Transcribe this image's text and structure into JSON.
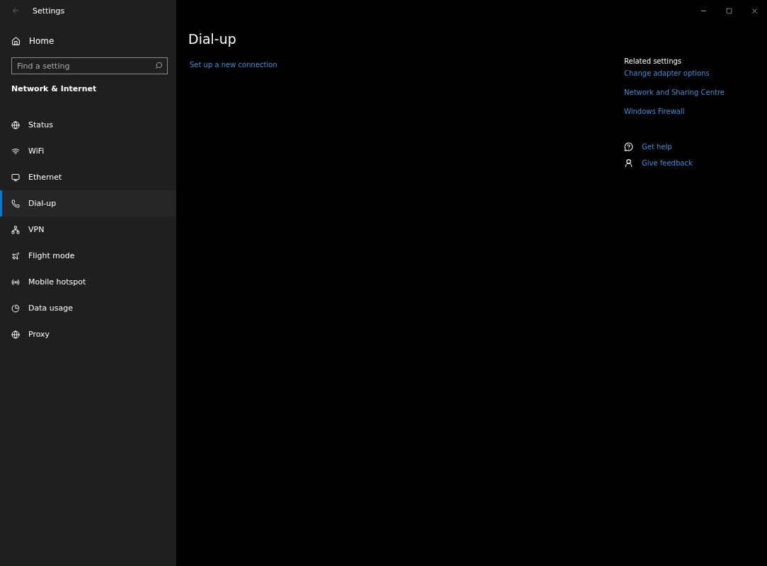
{
  "window": {
    "title": "Settings"
  },
  "sidebar": {
    "home": "Home",
    "search": {
      "placeholder": "Find a setting"
    },
    "section": "Network & Internet",
    "items": [
      {
        "label": "Status",
        "kind": "status",
        "selected": false
      },
      {
        "label": "WiFi",
        "kind": "wifi",
        "selected": false
      },
      {
        "label": "Ethernet",
        "kind": "ethernet",
        "selected": false
      },
      {
        "label": "Dial-up",
        "kind": "dialup",
        "selected": true
      },
      {
        "label": "VPN",
        "kind": "vpn",
        "selected": false
      },
      {
        "label": "Flight mode",
        "kind": "flight",
        "selected": false
      },
      {
        "label": "Mobile hotspot",
        "kind": "hotspot",
        "selected": false
      },
      {
        "label": "Data usage",
        "kind": "data",
        "selected": false
      },
      {
        "label": "Proxy",
        "kind": "proxy",
        "selected": false
      }
    ]
  },
  "main": {
    "title": "Dial-up",
    "link": "Set up a new connection"
  },
  "related": {
    "heading": "Related settings",
    "links": [
      "Change adapter options",
      "Network and Sharing Centre",
      "Windows Firewall"
    ],
    "help": [
      {
        "label": "Get help",
        "kind": "help"
      },
      {
        "label": "Give feedback",
        "kind": "feedback"
      }
    ]
  }
}
